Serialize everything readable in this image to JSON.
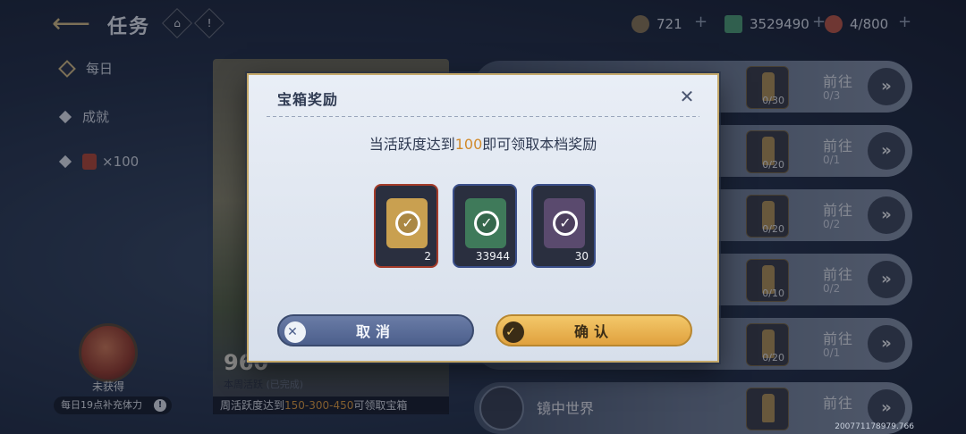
{
  "topbar": {
    "title": "任务",
    "back_icon": "back-arrow-icon",
    "home_icon": "⌂",
    "info_icon": "!",
    "resources": [
      {
        "icon": "coin-icon",
        "color": "#8c7a5a",
        "value": "721"
      },
      {
        "icon": "money-icon",
        "color": "#4fa37a",
        "value": "3529490"
      },
      {
        "icon": "meat-icon",
        "color": "#c25a4a",
        "value": "4/800"
      }
    ],
    "plus_label": "+"
  },
  "nav": {
    "items": [
      {
        "label": "每日"
      },
      {
        "label": "成就"
      },
      {
        "label": "×100"
      }
    ]
  },
  "stamina": {
    "label": "未获得",
    "tip": "每日19点补充体力",
    "tip_icon": "!"
  },
  "background_panel": {
    "score": "960",
    "activity_label": "本周活跃",
    "activity_status": "(已完成)",
    "note_prefix": "周活跃度达到",
    "note_highlight": "150-300-450",
    "note_suffix": "可领取宝箱"
  },
  "tasks": [
    {
      "go": "前往",
      "progress": "0/3",
      "reward_count": "0/30",
      "name": ""
    },
    {
      "go": "前往",
      "progress": "0/1",
      "reward_count": "0/20",
      "name": ""
    },
    {
      "go": "前往",
      "progress": "0/2",
      "reward_count": "0/20",
      "name": ""
    },
    {
      "go": "前往",
      "progress": "0/2",
      "reward_count": "0/10",
      "name": ""
    },
    {
      "go": "前往",
      "progress": "0/1",
      "reward_count": "0/20",
      "name": ""
    },
    {
      "go": "前往",
      "progress": "",
      "reward_count": "",
      "name": "镜中世界"
    }
  ],
  "arrow_label": "»",
  "modal": {
    "title": "宝箱奖励",
    "close_icon": "✕",
    "msg_prefix": "当活跃度达到",
    "msg_value": "100",
    "msg_suffix": "即可领取本档奖励",
    "items": [
      {
        "quantity": "2",
        "border": "#a33b2a",
        "art": "#c9a050"
      },
      {
        "quantity": "33944",
        "border": "#3b4f8a",
        "art": "#3f7a5a"
      },
      {
        "quantity": "30",
        "border": "#3b4f8a",
        "art": "#5a4a6e"
      }
    ],
    "check_mark": "✓",
    "cancel_label": "取消",
    "cancel_icon": "✕",
    "confirm_label": "确认",
    "confirm_icon": "✓"
  },
  "build_id": "200771178979.766"
}
